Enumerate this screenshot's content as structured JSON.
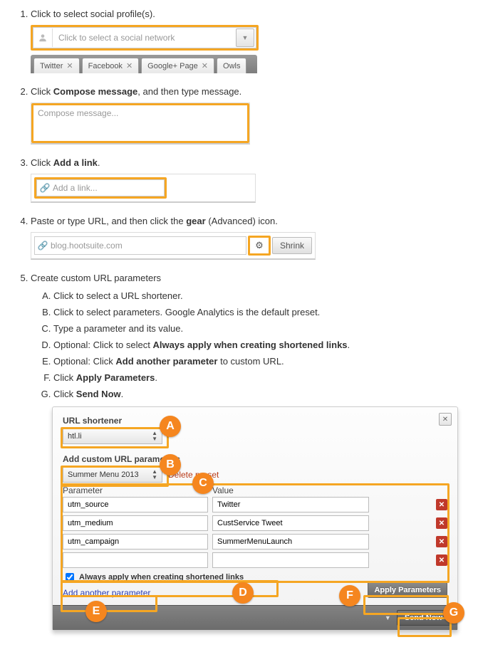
{
  "steps": {
    "s1": {
      "text": "Click to select social profile(s).",
      "placeholder": "Click to select a social network",
      "tabs": [
        "Twitter",
        "Facebook",
        "Google+ Page",
        "Owls"
      ]
    },
    "s2": {
      "text_a": "Click ",
      "bold": "Compose message",
      "text_b": ", and then type message.",
      "placeholder": "Compose message..."
    },
    "s3": {
      "text_a": "Click ",
      "bold": "Add a link",
      "text_b": ".",
      "placeholder": "Add a link..."
    },
    "s4": {
      "text_a": "Paste or type URL, and then click the ",
      "bold": "gear",
      "text_b": " (Advanced) icon.",
      "url": "blog.hootsuite.com",
      "shrink": "Shrink"
    },
    "s5": {
      "text": "Create custom URL parameters",
      "sub": {
        "a": "Click to select a URL shortener.",
        "b": "Click to select parameters. Google Analytics is the default preset.",
        "c": "Type a parameter and its value.",
        "d_a": "Optional: Click to select ",
        "d_bold": "Always apply when creating shortened links",
        "d_b": ".",
        "e_a": "Optional: Click ",
        "e_bold": "Add another parameter",
        "e_b": " to custom URL.",
        "f_a": "Click ",
        "f_bold": "Apply Parameters",
        "f_b": ".",
        "g_a": "Click ",
        "g_bold": "Send Now",
        "g_b": "."
      }
    }
  },
  "panel": {
    "shortener_label": "URL shortener",
    "shortener_value": "htl.li",
    "params_label": "Add custom URL parameters",
    "preset_value": "Summer Menu 2013",
    "delete_preset": "Delete preset",
    "col_param": "Parameter",
    "col_value": "Value",
    "rows": [
      {
        "p": "utm_source",
        "v": "Twitter"
      },
      {
        "p": "utm_medium",
        "v": "CustService Tweet"
      },
      {
        "p": "utm_campaign",
        "v": "SummerMenuLaunch"
      },
      {
        "p": "",
        "v": ""
      }
    ],
    "always_label": "Always apply when creating shortened links",
    "add_another": "Add another parameter",
    "apply": "Apply Parameters",
    "send": "Send Now"
  },
  "callouts": {
    "a": "A",
    "b": "B",
    "c": "C",
    "d": "D",
    "e": "E",
    "f": "F",
    "g": "G"
  }
}
